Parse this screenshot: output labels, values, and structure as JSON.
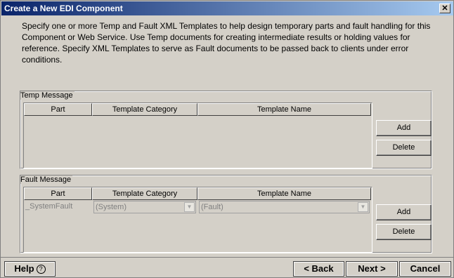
{
  "window": {
    "title": "Create a New EDI Component",
    "close_glyph": "✕"
  },
  "description": "Specify one or more Temp and Fault XML Templates to help design temporary parts and fault handling for this Component or Web Service.  Use Temp documents for creating intermediate results or holding values for reference. Specify XML Templates to serve as Fault documents to be passed back to clients under error conditions.",
  "temp_message": {
    "label": "Temp Message",
    "columns": [
      "Part",
      "Template Category",
      "Template Name"
    ],
    "rows": [],
    "add_label": "Add",
    "delete_label": "Delete"
  },
  "fault_message": {
    "label": "Fault Message",
    "columns": [
      "Part",
      "Template Category",
      "Template Name"
    ],
    "rows": [
      {
        "part": "_SystemFault",
        "category": "(System)",
        "name": "(Fault)"
      }
    ],
    "add_label": "Add",
    "delete_label": "Delete"
  },
  "footer": {
    "help_label": "Help",
    "help_icon": "?",
    "back_label": "< Back",
    "next_label": "Next >",
    "cancel_label": "Cancel"
  }
}
